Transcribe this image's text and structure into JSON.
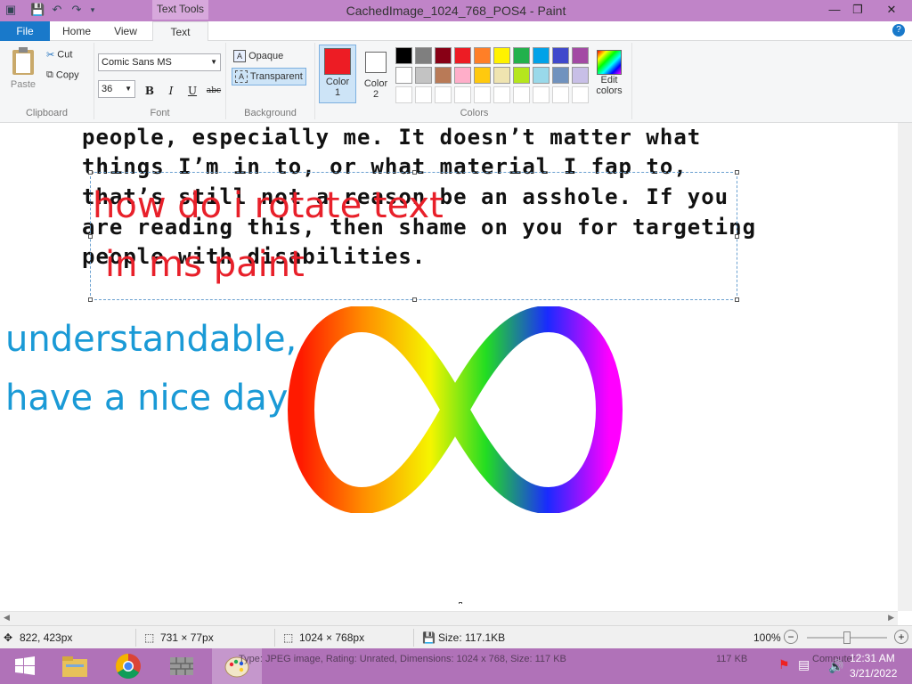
{
  "window": {
    "title": "CachedImage_1024_768_POS4 - Paint",
    "tool_tab": "Text Tools",
    "quick_access": [
      "save-icon",
      "undo-icon",
      "redo-icon",
      "dropdown-icon"
    ],
    "controls": [
      "minimize-icon",
      "restore-icon",
      "close-icon"
    ]
  },
  "tabs": {
    "file": "File",
    "home": "Home",
    "view": "View",
    "text": "Text",
    "help": "?"
  },
  "clipboard": {
    "paste": "Paste",
    "cut": "Cut",
    "copy": "Copy",
    "label": "Clipboard"
  },
  "font": {
    "family": "Comic Sans MS",
    "size": "36",
    "bold": "B",
    "italic": "I",
    "underline": "U",
    "strike": "abc",
    "label": "Font"
  },
  "background": {
    "opaque": "Opaque",
    "transparent": "Transparent",
    "label": "Background"
  },
  "colors": {
    "color1_label": "Color",
    "color1_num": "1",
    "color2_label": "Color",
    "color2_num": "2",
    "color1": "#ed1c24",
    "color2": "#ffffff",
    "row1": [
      "#000000",
      "#7f7f7f",
      "#880015",
      "#ed1c24",
      "#ff7f27",
      "#fff200",
      "#22b14c",
      "#00a2e8",
      "#3f48cc",
      "#a349a4"
    ],
    "row2": [
      "#ffffff",
      "#c3c3c3",
      "#b97a57",
      "#ffaec9",
      "#ffc90e",
      "#efe4b0",
      "#b5e61d",
      "#99d9ea",
      "#7092be",
      "#c8bfe7"
    ],
    "edit": "Edit",
    "edit2": "colors",
    "label": "Colors"
  },
  "canvas": {
    "lines": [
      "people, especially me. It doesn’t matter what",
      "things I’m in to, or what material I fap to,",
      "that’s still not a reason be an asshole. If you",
      "are reading this, then shame on you for targeting",
      "people with disabilities."
    ],
    "red1": "how do i rotate text",
    "red2": "in ms paint",
    "blue1": "understandable,",
    "blue2": "have a nice day"
  },
  "status": {
    "cursor": "822, 423px",
    "selection": "731 × 77px",
    "dimensions": "1024 × 768px",
    "size": "Size: 117.1KB",
    "zoom": "100%"
  },
  "taskbar": {
    "details": "Type: JPEG image, Rating: Unrated, Dimensions: 1024 x 768, Size: 117 KB",
    "kb": "117 KB",
    "computer": "Computer",
    "time": "12:31 AM",
    "date": "3/21/2022"
  }
}
